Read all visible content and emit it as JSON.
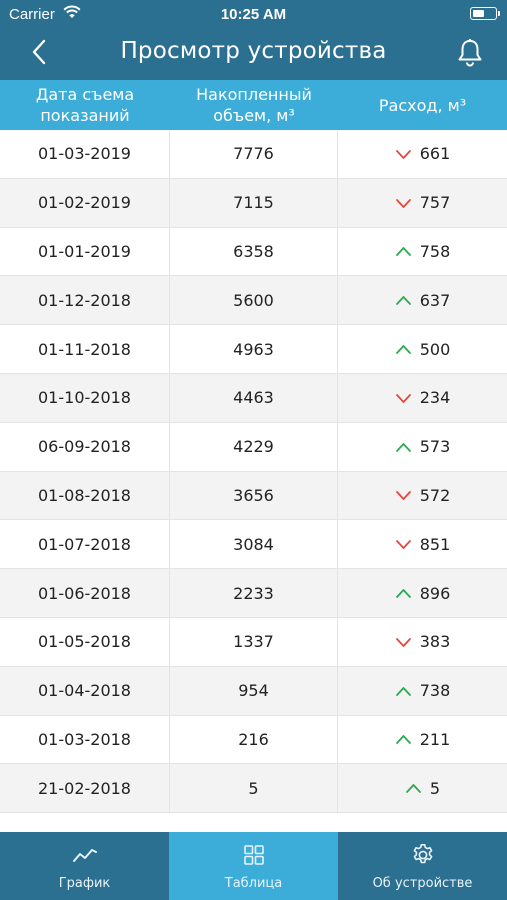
{
  "status_bar": {
    "carrier": "Carrier",
    "time": "10:25 AM",
    "battery_level": 0.55
  },
  "header": {
    "title": "Просмотр устройства",
    "back_icon": "chevron-left-icon",
    "bell_icon": "bell-icon"
  },
  "table": {
    "columns": [
      "Дата съема\nпоказаний",
      "Накопленный\nобъем, м³",
      "Расход, м³"
    ],
    "rows": [
      {
        "date": "01-03-2019",
        "volume": "7776",
        "consumption": "661",
        "trend": "down"
      },
      {
        "date": "01-02-2019",
        "volume": "7115",
        "consumption": "757",
        "trend": "down"
      },
      {
        "date": "01-01-2019",
        "volume": "6358",
        "consumption": "758",
        "trend": "up"
      },
      {
        "date": "01-12-2018",
        "volume": "5600",
        "consumption": "637",
        "trend": "up"
      },
      {
        "date": "01-11-2018",
        "volume": "4963",
        "consumption": "500",
        "trend": "up"
      },
      {
        "date": "01-10-2018",
        "volume": "4463",
        "consumption": "234",
        "trend": "down"
      },
      {
        "date": "06-09-2018",
        "volume": "4229",
        "consumption": "573",
        "trend": "up"
      },
      {
        "date": "01-08-2018",
        "volume": "3656",
        "consumption": "572",
        "trend": "down"
      },
      {
        "date": "01-07-2018",
        "volume": "3084",
        "consumption": "851",
        "trend": "down"
      },
      {
        "date": "01-06-2018",
        "volume": "2233",
        "consumption": "896",
        "trend": "up"
      },
      {
        "date": "01-05-2018",
        "volume": "1337",
        "consumption": "383",
        "trend": "down"
      },
      {
        "date": "01-04-2018",
        "volume": "954",
        "consumption": "738",
        "trend": "up"
      },
      {
        "date": "01-03-2018",
        "volume": "216",
        "consumption": "211",
        "trend": "up"
      },
      {
        "date": "21-02-2018",
        "volume": "5",
        "consumption": "5",
        "trend": "up"
      }
    ]
  },
  "tabs": [
    {
      "label": "График",
      "icon": "chart-line-icon",
      "active": false
    },
    {
      "label": "Таблица",
      "icon": "grid-icon",
      "active": true
    },
    {
      "label": "Об устройстве",
      "icon": "gear-icon",
      "active": false
    }
  ],
  "colors": {
    "header": "#2b6f91",
    "accent": "#3cadd9",
    "up": "#2fa84f",
    "down": "#e3483c"
  }
}
